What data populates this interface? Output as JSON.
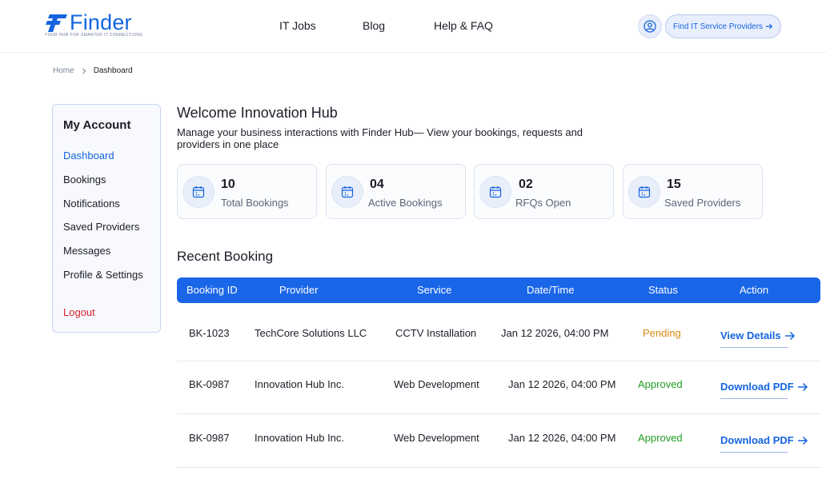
{
  "header": {
    "logo_text": "Finder",
    "logo_tagline": "YOUR HUB FOR SMARTER IT CONNECTIONS",
    "nav": [
      "IT Jobs",
      "Blog",
      "Help & FAQ"
    ],
    "cta_label": "Find IT Service Providers",
    "accent_color": "#1565e0"
  },
  "breadcrumb": {
    "home": "Home",
    "current": "Dashboard"
  },
  "sidebar": {
    "title": "My Account",
    "items": [
      "Dashboard",
      "Bookings",
      "Notifications",
      "Saved Providers",
      "Messages",
      "Profile & Settings"
    ],
    "active_item": "Dashboard",
    "logout": "Logout"
  },
  "welcome": {
    "title": "Welcome Innovation Hub",
    "description": "Manage your business interactions with Finder Hub— View your bookings, requests and providers in one place"
  },
  "stats": [
    {
      "value": "10",
      "label": "Total Bookings",
      "icon": "calendar-icon"
    },
    {
      "value": "04",
      "label": "Active Bookings",
      "icon": "calendar-icon"
    },
    {
      "value": "02",
      "label": "RFQs Open",
      "icon": "calendar-icon"
    },
    {
      "value": "15",
      "label": "Saved Providers",
      "icon": "calendar-icon"
    }
  ],
  "recent": {
    "title": "Recent Booking",
    "columns": [
      "Booking ID",
      "Provider",
      "Service",
      "Date/Time",
      "Status",
      "Action"
    ],
    "rows": [
      {
        "id": "BK-1023",
        "provider": "TechCore Solutions LLC",
        "service": "CCTV Installation",
        "datetime": "Jan 12 2026, 04:00 PM",
        "status": "Pending",
        "action": "View Details"
      },
      {
        "id": "BK-0987",
        "provider": "Innovation Hub Inc.",
        "service": "Web Development",
        "datetime": "Jan 12 2026, 04:00 PM",
        "status": "Approved",
        "action": "Download PDF"
      },
      {
        "id": "BK-0987",
        "provider": "Innovation Hub Inc.",
        "service": "Web Development",
        "datetime": "Jan 12 2026, 04:00 PM",
        "status": "Approved",
        "action": "Download PDF"
      }
    ]
  }
}
